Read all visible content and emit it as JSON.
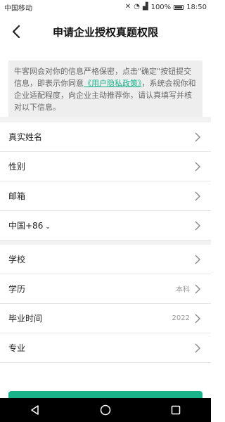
{
  "status_bar": {
    "carrier": "中国移动",
    "battery": "100%",
    "time": "18:50"
  },
  "header": {
    "title": "申请企业授权真题权限"
  },
  "notice": {
    "text_before": "牛客网会对你的信息严格保密，点击\"确定\"按钮提交信息，即表示你同意",
    "link_text": "《用户隐私政策》",
    "text_after": "，系统会视你和企业适配程度，向企业主动推荐你，请认真填写并核对以下信息。"
  },
  "form": {
    "name_label": "真实姓名",
    "gender_label": "性别",
    "email_label": "邮箱",
    "country_code_label": "中国+86",
    "school_label": "学校",
    "degree_label": "学历",
    "degree_value": "本科",
    "grad_label": "毕业时间",
    "grad_value": "2022",
    "major_label": "专业"
  },
  "colors": {
    "accent": "#19b38a",
    "notice_bg": "#eeeeee",
    "separator": "#f2f2f2"
  }
}
